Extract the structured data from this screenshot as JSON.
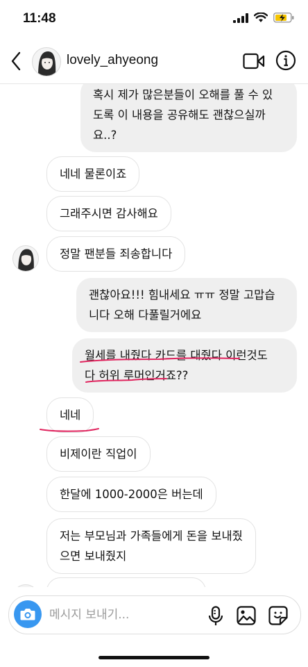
{
  "status_bar": {
    "time": "11:48"
  },
  "header": {
    "username": "lovely_ahyeong"
  },
  "messages": [
    {
      "side": "out",
      "lines": [
        "혹시 제가 많은분들이 오해를 풀 수 있",
        "도록 이 내용을 공유해도 괜찮으실까",
        "요..?"
      ]
    },
    {
      "side": "in",
      "lines": [
        "네네 물론이죠"
      ]
    },
    {
      "side": "in",
      "lines": [
        "그래주시면 감사해요"
      ]
    },
    {
      "side": "in",
      "lines": [
        "정말 팬분들 죄송합니다"
      ]
    },
    {
      "side": "out",
      "lines": [
        "괜찮아요!!! 힘내세요 ㅠㅠ 정말 고맙습",
        "니다 오해 다풀릴거에요"
      ]
    },
    {
      "side": "out",
      "lines": [
        "월세를 내줬다 카드를 대줬다 이런것도",
        "다 허위 루머인거죠??"
      ]
    },
    {
      "side": "in",
      "lines": [
        "네네"
      ]
    },
    {
      "side": "in",
      "lines": [
        "비제이란 직업이"
      ]
    },
    {
      "side": "in",
      "lines": [
        "한달에 1000-2000은 버는데"
      ]
    },
    {
      "side": "in",
      "lines": [
        "저는 부모님과 가족들에게 돈을 보내줬",
        "으면 보내줬지"
      ]
    }
  ],
  "composer": {
    "placeholder": "메시지 보내기..."
  },
  "colors": {
    "accent": "#3897f0",
    "annotation": "#e0245e",
    "outgoing_bubble": "#efefef"
  }
}
